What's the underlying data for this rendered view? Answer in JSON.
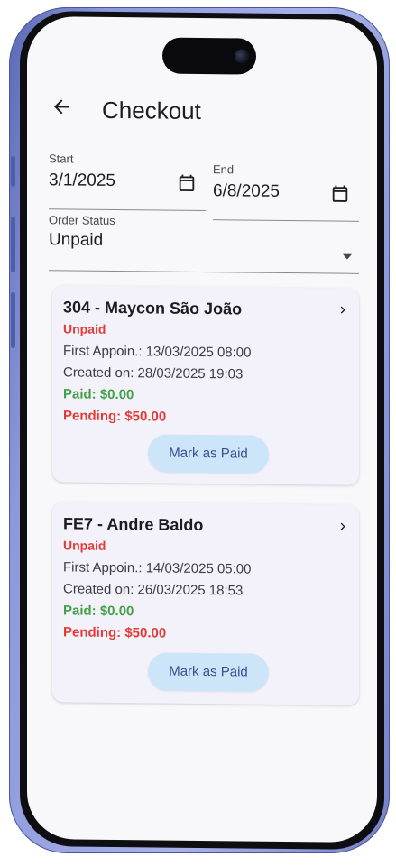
{
  "header": {
    "title": "Checkout"
  },
  "filters": {
    "start": {
      "label": "Start",
      "value": "3/1/2025"
    },
    "end": {
      "label": "End",
      "value": "6/8/2025"
    },
    "status": {
      "label": "Order Status",
      "value": "Unpaid"
    }
  },
  "orders": [
    {
      "name": "304 - Maycon São João",
      "status": "Unpaid",
      "first_appointment": "First Appoin.: 13/03/2025 08:00",
      "created_on": "Created on: 28/03/2025 19:03",
      "paid": "Paid: $0.00",
      "pending": "Pending: $50.00",
      "action": "Mark as Paid"
    },
    {
      "name": "FE7 - Andre Baldo",
      "status": "Unpaid",
      "first_appointment": "First Appoin.: 14/03/2025 05:00",
      "created_on": "Created on: 26/03/2025 18:53",
      "paid": "Paid: $0.00",
      "pending": "Pending: $50.00",
      "action": "Mark as Paid"
    }
  ],
  "icons": {
    "back": "arrow-back-icon",
    "calendar": "calendar-icon",
    "dropdown": "dropdown-arrow-icon",
    "chevron": "chevron-right-icon"
  },
  "colors": {
    "unpaid": "#e53935",
    "paid": "#43a047",
    "button_bg": "#cde5f8",
    "frame": "#8d99dc"
  }
}
